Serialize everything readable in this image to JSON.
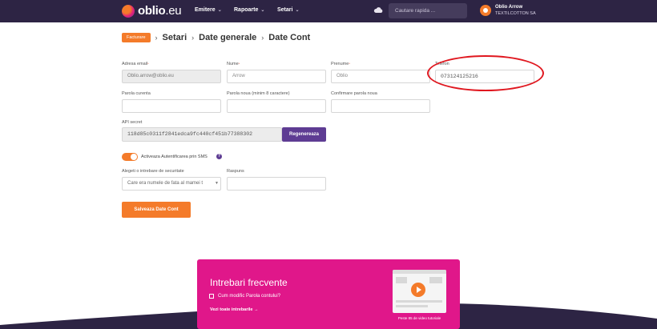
{
  "brand": {
    "name": "oblio",
    "tld": ".eu"
  },
  "nav": [
    {
      "label": "Emitere"
    },
    {
      "label": "Rapoarte"
    },
    {
      "label": "Setari"
    }
  ],
  "search": {
    "placeholder": "Cautare rapida ..."
  },
  "user": {
    "name": "Oblio Arrow",
    "company": "TEXTILCOTTON SA"
  },
  "breadcrumb": {
    "badge": "Facturare",
    "items": [
      "Setari",
      "Date generale",
      "Date Cont"
    ]
  },
  "form": {
    "email": {
      "label": "Adresa email",
      "value": "Oblio.arrow@oblio.eu"
    },
    "nume": {
      "label": "Nume",
      "value": "Arrow"
    },
    "prenume": {
      "label": "Prenume",
      "value": "Oblio"
    },
    "telefon": {
      "label": "Telefon",
      "value": "073124125216"
    },
    "parola_curenta": {
      "label": "Parola curenta"
    },
    "parola_noua": {
      "label": "Parola noua (minim 8 caractere)"
    },
    "confirmare": {
      "label": "Confirmare parola noua"
    },
    "api": {
      "label": "API secret",
      "value": "118d85c0311f2841edca9fc440cf451b77388302",
      "button": "Regenereaza"
    },
    "sms_toggle": {
      "label": "Activeaza Autentificarea prin SMS",
      "on": true
    },
    "intrebare": {
      "label": "Alegeti o intrebare de securitate",
      "value": "Care era numele de fata al mamei t"
    },
    "raspuns": {
      "label": "Raspuns"
    },
    "save_button": "Salveaza Date Cont"
  },
  "faq": {
    "title": "Intrebari frecvente",
    "question": "Cum modific Parola contului?",
    "link": "Vezi toate intrebarile  →",
    "caption": "Peste 85 de video tutoriale"
  },
  "colors": {
    "header": "#2d2444",
    "accent": "#f47b2a",
    "purple": "#5e3c93",
    "faq": "#e0178a",
    "highlight": "#e0171f"
  }
}
